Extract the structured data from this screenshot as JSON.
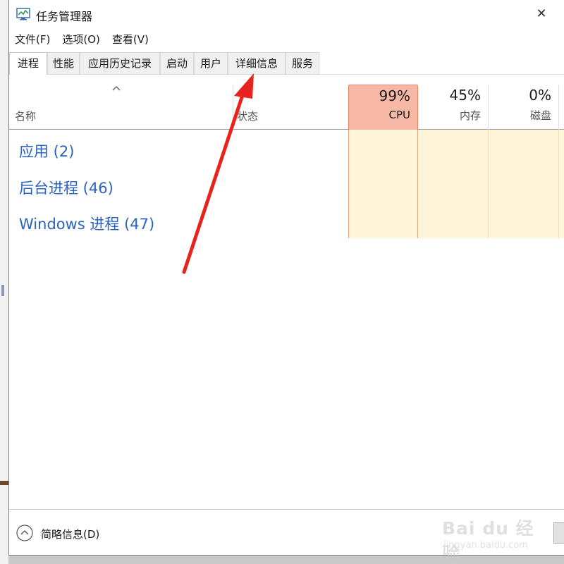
{
  "window": {
    "title": "任务管理器",
    "close_glyph": "✕"
  },
  "menu": [
    "文件(F)",
    "选项(O)",
    "查看(V)"
  ],
  "tabs": [
    "进程",
    "性能",
    "应用历史记录",
    "启动",
    "用户",
    "详细信息",
    "服务"
  ],
  "active_tab": "进程",
  "columns": {
    "name": "名称",
    "status": "状态",
    "cpu": {
      "percent": "99%",
      "label": "CPU"
    },
    "memory": {
      "percent": "45%",
      "label": "内存"
    },
    "disk": {
      "percent": "0%",
      "label": "磁盘"
    }
  },
  "groups": [
    "应用 (2)",
    "后台进程 (46)",
    "Windows 进程 (47)"
  ],
  "footer": {
    "fewer_details": "简略信息(D)"
  },
  "watermark": {
    "text": "Bai du 经验",
    "url": "jingyan.baidu.com"
  },
  "colors": {
    "link_blue": "#2a63c0",
    "cpu_highlight": "#f7b8a6",
    "cell_fill": "#fff6da",
    "annotation_red": "#e8231f"
  },
  "icons": [
    "task-manager-icon",
    "close-icon",
    "sort-up-icon",
    "collapse-up-icon",
    "red-arrow-annotation"
  ]
}
